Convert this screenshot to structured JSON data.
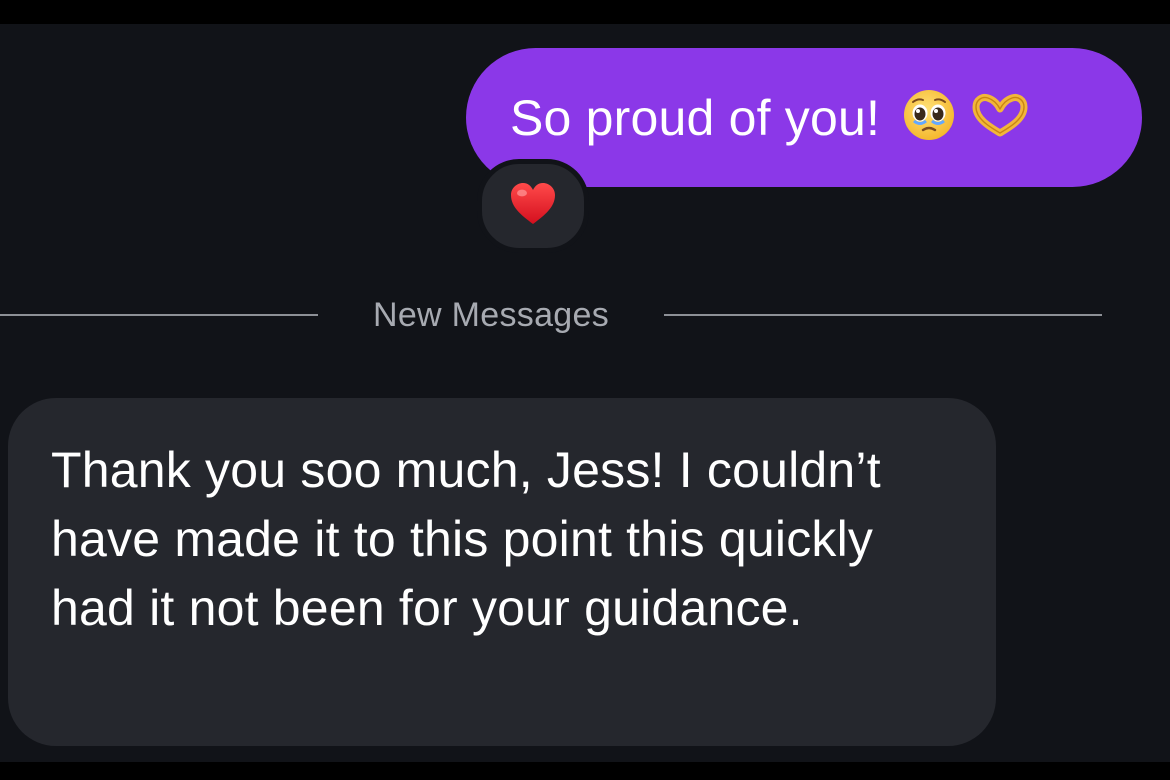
{
  "messages": {
    "outgoing": {
      "text": "So proud of you!",
      "emojis": [
        "pleading-face-emoji",
        "heart-hands-emoji"
      ]
    },
    "reaction": {
      "emoji": "red-heart-emoji"
    },
    "divider_label": "New Messages",
    "incoming": {
      "text": "Thank you soo much, Jess! I couldn’t have made it to this point this quickly had it not been for your guidance."
    }
  },
  "colors": {
    "outgoing_bubble": "#8b38e8",
    "incoming_bubble": "#25272d",
    "background": "#111318",
    "divider": "#8d9096"
  }
}
